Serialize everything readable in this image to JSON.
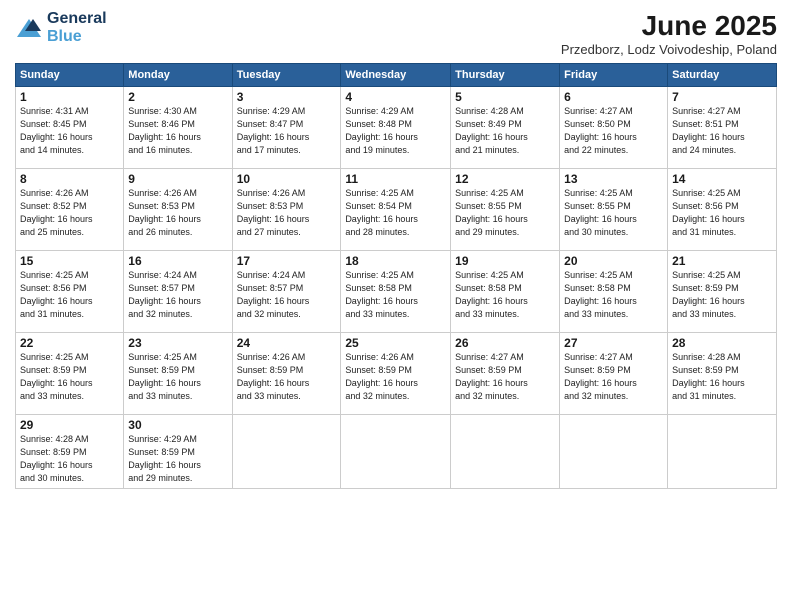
{
  "logo": {
    "line1": "General",
    "line2": "Blue"
  },
  "title": "June 2025",
  "location": "Przedborz, Lodz Voivodeship, Poland",
  "days_of_week": [
    "Sunday",
    "Monday",
    "Tuesday",
    "Wednesday",
    "Thursday",
    "Friday",
    "Saturday"
  ],
  "weeks": [
    [
      {
        "day": 1,
        "info": "Sunrise: 4:31 AM\nSunset: 8:45 PM\nDaylight: 16 hours\nand 14 minutes."
      },
      {
        "day": 2,
        "info": "Sunrise: 4:30 AM\nSunset: 8:46 PM\nDaylight: 16 hours\nand 16 minutes."
      },
      {
        "day": 3,
        "info": "Sunrise: 4:29 AM\nSunset: 8:47 PM\nDaylight: 16 hours\nand 17 minutes."
      },
      {
        "day": 4,
        "info": "Sunrise: 4:29 AM\nSunset: 8:48 PM\nDaylight: 16 hours\nand 19 minutes."
      },
      {
        "day": 5,
        "info": "Sunrise: 4:28 AM\nSunset: 8:49 PM\nDaylight: 16 hours\nand 21 minutes."
      },
      {
        "day": 6,
        "info": "Sunrise: 4:27 AM\nSunset: 8:50 PM\nDaylight: 16 hours\nand 22 minutes."
      },
      {
        "day": 7,
        "info": "Sunrise: 4:27 AM\nSunset: 8:51 PM\nDaylight: 16 hours\nand 24 minutes."
      }
    ],
    [
      {
        "day": 8,
        "info": "Sunrise: 4:26 AM\nSunset: 8:52 PM\nDaylight: 16 hours\nand 25 minutes."
      },
      {
        "day": 9,
        "info": "Sunrise: 4:26 AM\nSunset: 8:53 PM\nDaylight: 16 hours\nand 26 minutes."
      },
      {
        "day": 10,
        "info": "Sunrise: 4:26 AM\nSunset: 8:53 PM\nDaylight: 16 hours\nand 27 minutes."
      },
      {
        "day": 11,
        "info": "Sunrise: 4:25 AM\nSunset: 8:54 PM\nDaylight: 16 hours\nand 28 minutes."
      },
      {
        "day": 12,
        "info": "Sunrise: 4:25 AM\nSunset: 8:55 PM\nDaylight: 16 hours\nand 29 minutes."
      },
      {
        "day": 13,
        "info": "Sunrise: 4:25 AM\nSunset: 8:55 PM\nDaylight: 16 hours\nand 30 minutes."
      },
      {
        "day": 14,
        "info": "Sunrise: 4:25 AM\nSunset: 8:56 PM\nDaylight: 16 hours\nand 31 minutes."
      }
    ],
    [
      {
        "day": 15,
        "info": "Sunrise: 4:25 AM\nSunset: 8:56 PM\nDaylight: 16 hours\nand 31 minutes."
      },
      {
        "day": 16,
        "info": "Sunrise: 4:24 AM\nSunset: 8:57 PM\nDaylight: 16 hours\nand 32 minutes."
      },
      {
        "day": 17,
        "info": "Sunrise: 4:24 AM\nSunset: 8:57 PM\nDaylight: 16 hours\nand 32 minutes."
      },
      {
        "day": 18,
        "info": "Sunrise: 4:25 AM\nSunset: 8:58 PM\nDaylight: 16 hours\nand 33 minutes."
      },
      {
        "day": 19,
        "info": "Sunrise: 4:25 AM\nSunset: 8:58 PM\nDaylight: 16 hours\nand 33 minutes."
      },
      {
        "day": 20,
        "info": "Sunrise: 4:25 AM\nSunset: 8:58 PM\nDaylight: 16 hours\nand 33 minutes."
      },
      {
        "day": 21,
        "info": "Sunrise: 4:25 AM\nSunset: 8:59 PM\nDaylight: 16 hours\nand 33 minutes."
      }
    ],
    [
      {
        "day": 22,
        "info": "Sunrise: 4:25 AM\nSunset: 8:59 PM\nDaylight: 16 hours\nand 33 minutes."
      },
      {
        "day": 23,
        "info": "Sunrise: 4:25 AM\nSunset: 8:59 PM\nDaylight: 16 hours\nand 33 minutes."
      },
      {
        "day": 24,
        "info": "Sunrise: 4:26 AM\nSunset: 8:59 PM\nDaylight: 16 hours\nand 33 minutes."
      },
      {
        "day": 25,
        "info": "Sunrise: 4:26 AM\nSunset: 8:59 PM\nDaylight: 16 hours\nand 32 minutes."
      },
      {
        "day": 26,
        "info": "Sunrise: 4:27 AM\nSunset: 8:59 PM\nDaylight: 16 hours\nand 32 minutes."
      },
      {
        "day": 27,
        "info": "Sunrise: 4:27 AM\nSunset: 8:59 PM\nDaylight: 16 hours\nand 32 minutes."
      },
      {
        "day": 28,
        "info": "Sunrise: 4:28 AM\nSunset: 8:59 PM\nDaylight: 16 hours\nand 31 minutes."
      }
    ],
    [
      {
        "day": 29,
        "info": "Sunrise: 4:28 AM\nSunset: 8:59 PM\nDaylight: 16 hours\nand 30 minutes."
      },
      {
        "day": 30,
        "info": "Sunrise: 4:29 AM\nSunset: 8:59 PM\nDaylight: 16 hours\nand 29 minutes."
      },
      null,
      null,
      null,
      null,
      null
    ]
  ]
}
